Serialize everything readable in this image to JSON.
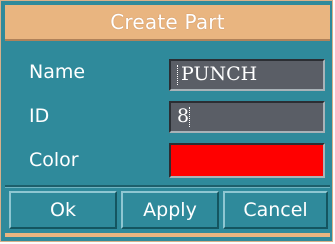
{
  "dialog": {
    "title": "Create Part",
    "fields": {
      "name": {
        "label": "Name",
        "value": "PUNCH"
      },
      "id": {
        "label": "ID",
        "value": "8"
      },
      "color": {
        "label": "Color",
        "value": "#ff0000"
      }
    },
    "buttons": {
      "ok": "Ok",
      "apply": "Apply",
      "cancel": "Cancel"
    }
  },
  "colors": {
    "dialog_bg": "#2f8a9b",
    "titlebar_bg": "#e9b580",
    "field_bg": "#5a5e66",
    "selected_color": "#ff0000"
  }
}
